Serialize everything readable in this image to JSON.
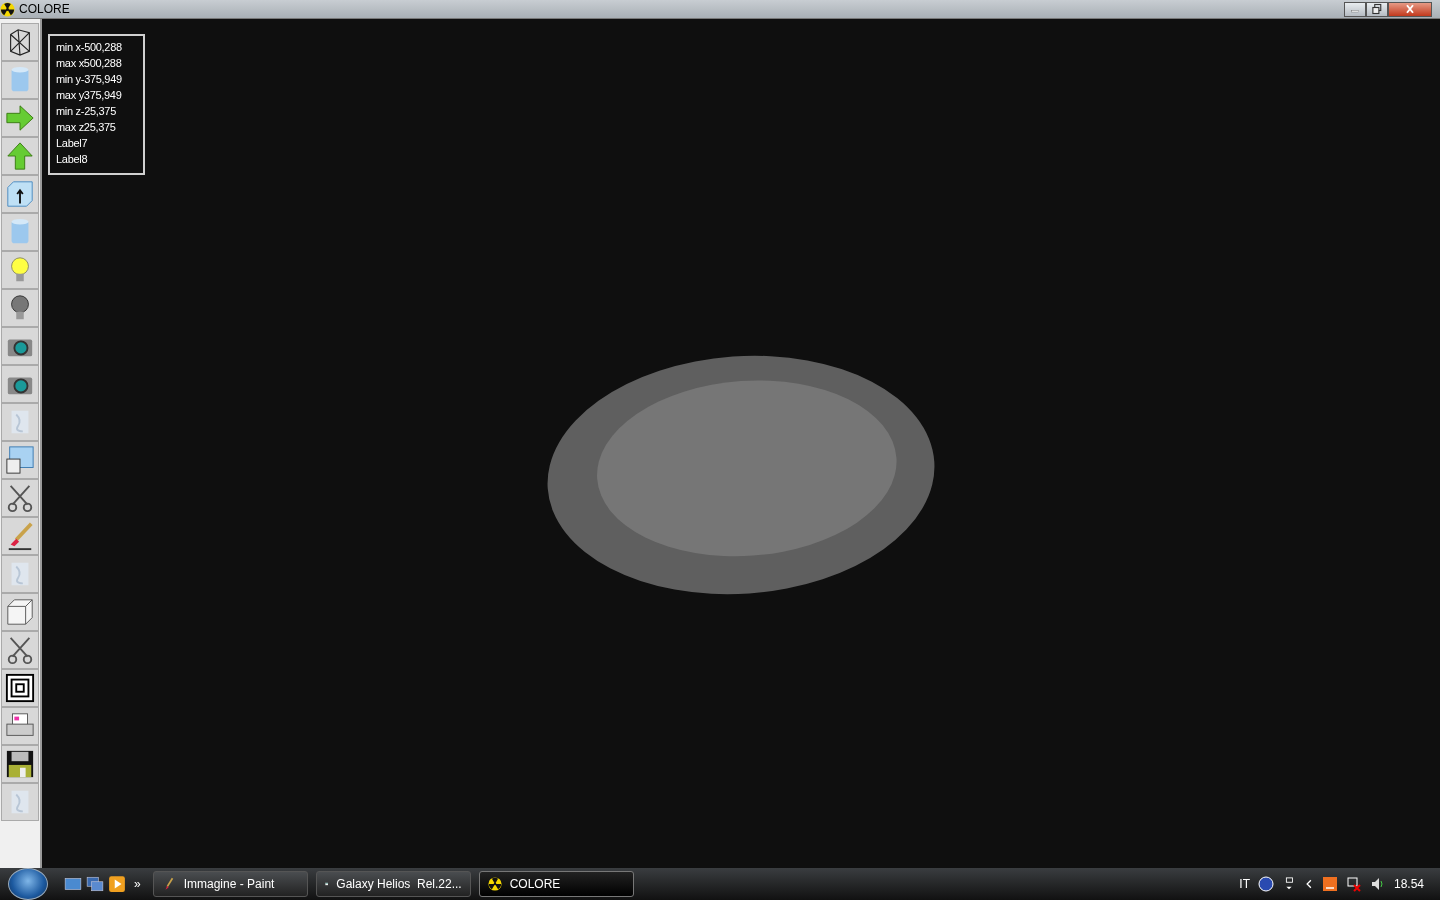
{
  "window": {
    "title": "COLORE"
  },
  "toolbar": [
    {
      "kind": "wireframe"
    },
    {
      "kind": "cylinder"
    },
    {
      "kind": "arrow-right"
    },
    {
      "kind": "arrow-up"
    },
    {
      "kind": "box-arrow"
    },
    {
      "kind": "cylinder"
    },
    {
      "kind": "bulb-on"
    },
    {
      "kind": "bulb-off"
    },
    {
      "kind": "camera"
    },
    {
      "kind": "camera"
    },
    {
      "kind": "texture"
    },
    {
      "kind": "windows"
    },
    {
      "kind": "scissors"
    },
    {
      "kind": "brush"
    },
    {
      "kind": "texture"
    },
    {
      "kind": "cube"
    },
    {
      "kind": "scissors"
    },
    {
      "kind": "squares"
    },
    {
      "kind": "printer"
    },
    {
      "kind": "floppy"
    },
    {
      "kind": "texture"
    }
  ],
  "info_labels": [
    "min x-500,288",
    "max x500,288",
    "min y-375,949",
    "max y375,949",
    "min z-25,375",
    "max z25,375",
    "Label7",
    "Label8"
  ],
  "taskbar": {
    "quick_launch_more": "»",
    "tasks": [
      {
        "label": "Immagine - Paint",
        "kind": "paint",
        "selected": false
      },
      {
        "label": "Galaxy Helios  Rel.22...",
        "kind": "window",
        "selected": false
      },
      {
        "label": "COLORE",
        "kind": "radiation",
        "selected": true
      }
    ],
    "language": "IT",
    "clock": "18.54"
  }
}
